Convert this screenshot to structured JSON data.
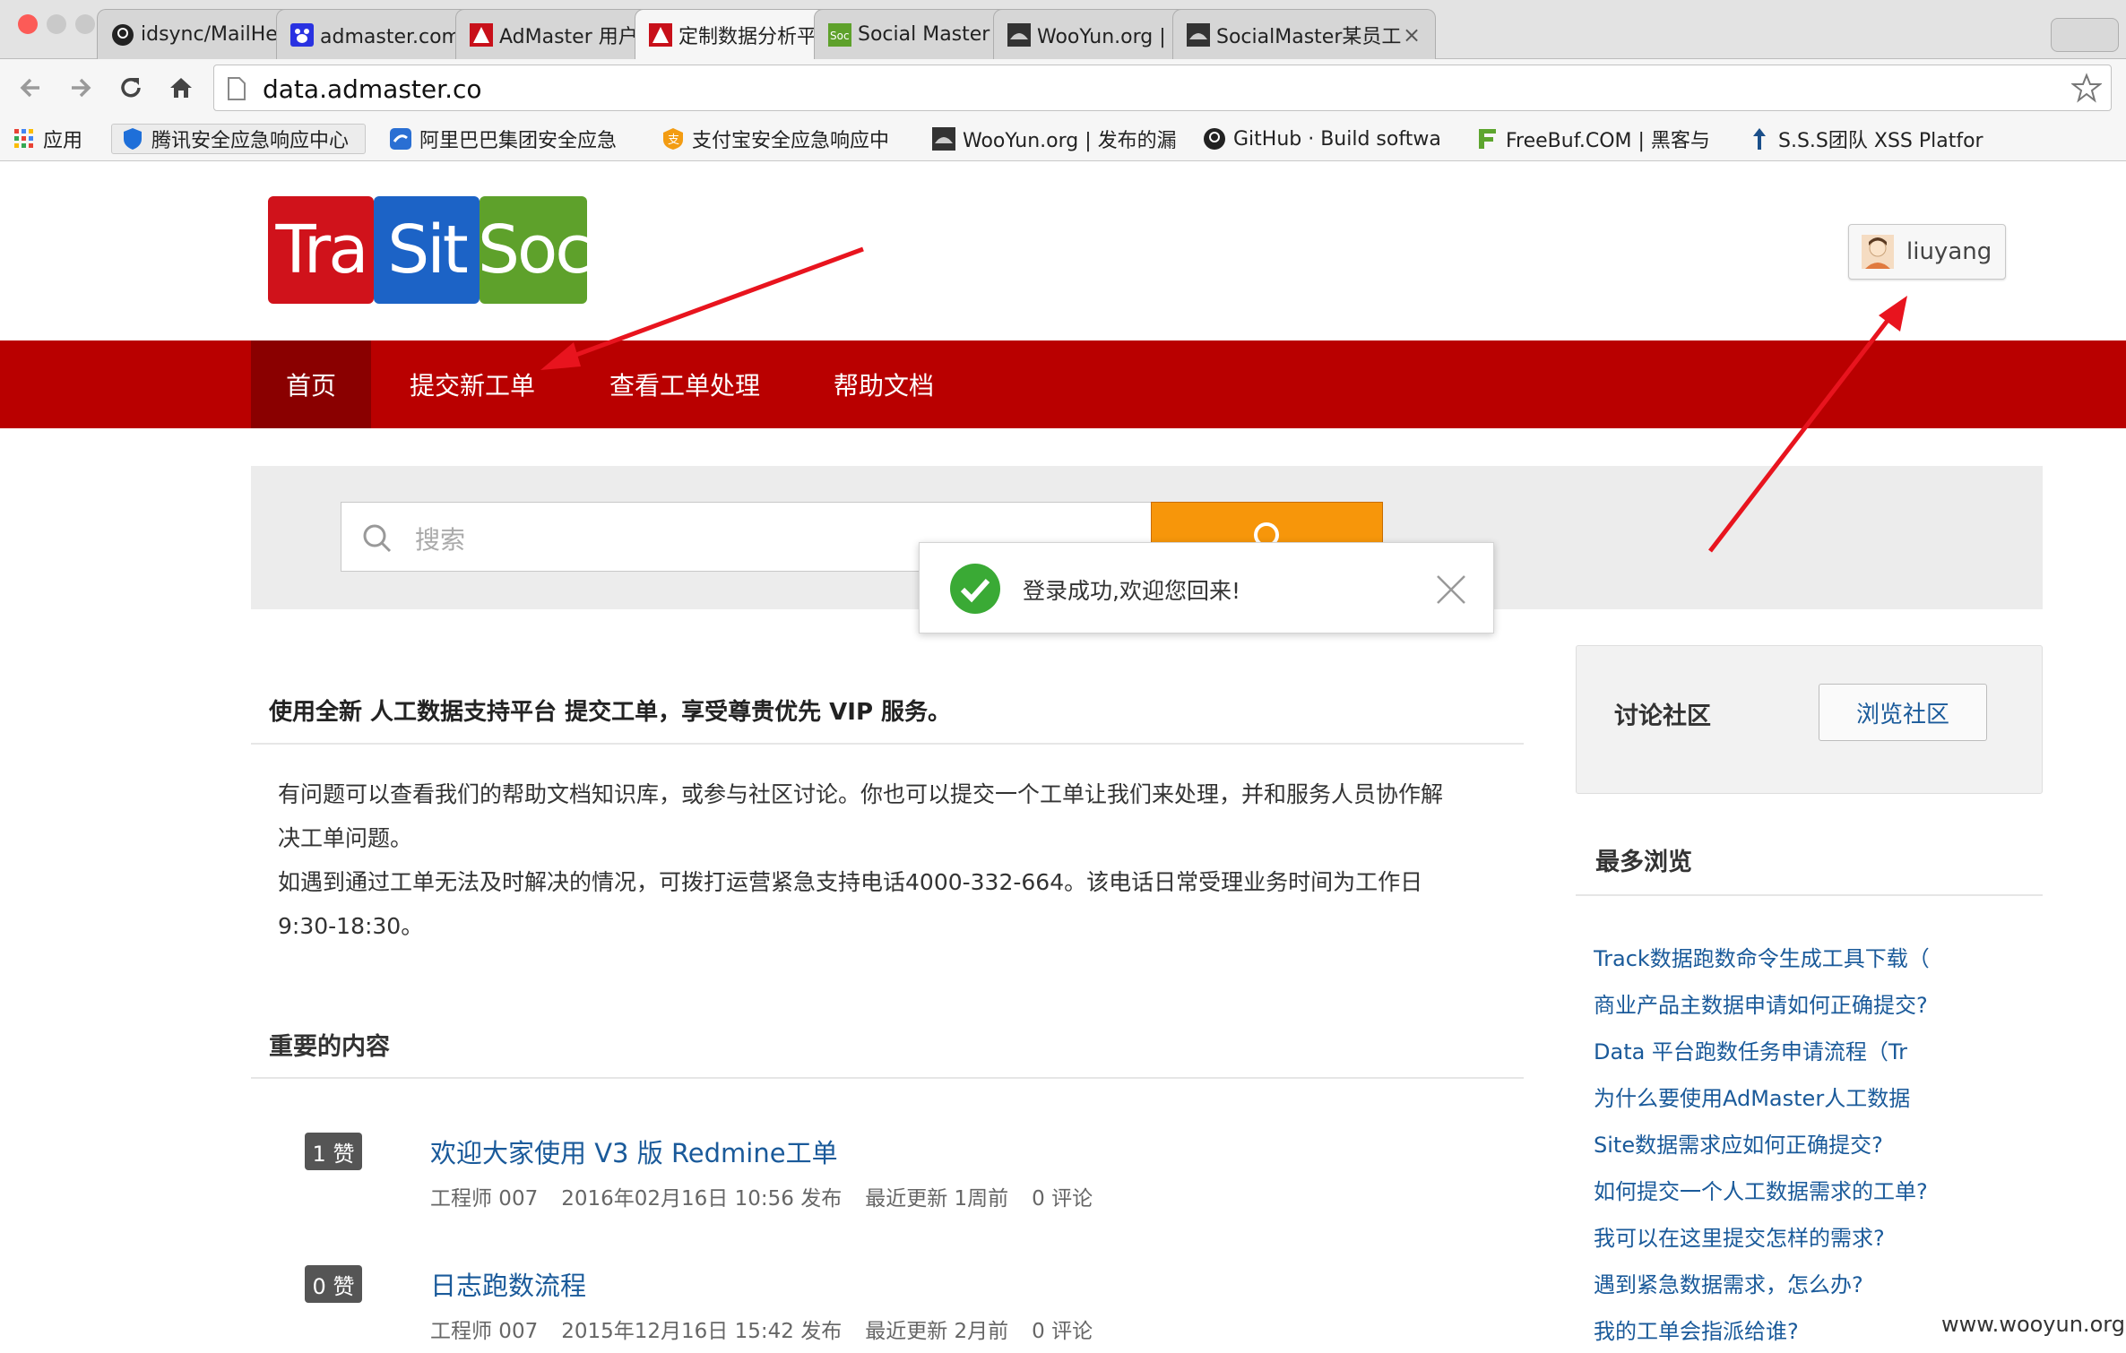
{
  "browser": {
    "tabs": [
      {
        "title": "idsync/MailHelper",
        "icon": "github-icon"
      },
      {
        "title": "admaster.com.cn_百",
        "icon": "baidu-paw-icon"
      },
      {
        "title": "AdMaster 用户中心",
        "icon": "admaster-icon"
      },
      {
        "title": "定制数据分析平台 -",
        "icon": "admaster-icon",
        "active": true
      },
      {
        "title": "Social Master - Adm",
        "icon": "soc-icon"
      },
      {
        "title": "WooYun.org | 提交漏",
        "icon": "wooyun-icon"
      },
      {
        "title": "SocialMaster某员工",
        "icon": "wooyun-icon"
      }
    ],
    "url": "data.admaster.co",
    "bookmarks": [
      {
        "label": "应用",
        "icon": "apps-grid-icon"
      },
      {
        "label": "腾讯安全应急响应中心",
        "icon": "tencent-shield-icon"
      },
      {
        "label": "阿里巴巴集团安全应急",
        "icon": "alibaba-icon"
      },
      {
        "label": "支付宝安全应急响应中",
        "icon": "alipay-icon"
      },
      {
        "label": "WooYun.org | 发布的漏",
        "icon": "wooyun-icon"
      },
      {
        "label": "GitHub · Build softwa",
        "icon": "github-icon"
      },
      {
        "label": "FreeBuf.COM | 黑客与",
        "icon": "freebuf-icon"
      },
      {
        "label": "S.S.S团队 XSS Platfor",
        "icon": "pin-icon"
      }
    ]
  },
  "logo": {
    "parts": [
      "Tra",
      "Sit",
      "Soc"
    ],
    "colors": [
      "#d0121b",
      "#1c63c6",
      "#5ea12b"
    ]
  },
  "user": {
    "name": "liuyang"
  },
  "nav": {
    "items": [
      "首页",
      "提交新工单",
      "查看工单处理",
      "帮助文档"
    ]
  },
  "search": {
    "placeholder": "搜索"
  },
  "toast": {
    "message": "登录成功,欢迎您回来!"
  },
  "intro": {
    "title": "使用全新 人工数据支持平台 提交工单，享受尊贵优先 VIP 服务。",
    "lines": [
      "有问题可以查看我们的帮助文档知识库，或参与社区讨论。你也可以提交一个工单让我们来处理，并和服务人员协作解",
      "决工单问题。",
      "如遇到通过工单无法及时解决的情况，可拨打运营紧急支持电话4000-332-664。该电话日常受理业务时间为工作日",
      "9:30-18:30。"
    ]
  },
  "important": {
    "title": "重要的内容",
    "articles": [
      {
        "votes": "1 赞",
        "title": "欢迎大家使用 V3 版 Redmine工单",
        "author": "工程师 007",
        "published": "2016年02月16日 10:56 发布",
        "updated": "最近更新 1周前",
        "comments": "0 评论"
      },
      {
        "votes": "0 赞",
        "title": "日志跑数流程",
        "author": "工程师 007",
        "published": "2015年12月16日 15:42 发布",
        "updated": "最近更新 2月前",
        "comments": "0 评论"
      }
    ]
  },
  "community": {
    "label": "讨论社区",
    "button": "浏览社区"
  },
  "most_viewed": {
    "title": "最多浏览",
    "items": [
      "Track数据跑数命令生成工具下载（",
      "商业产品主数据申请如何正确提交?",
      "Data 平台跑数任务申请流程（Tr",
      "为什么要使用AdMaster人工数据",
      "Site数据需求应如何正确提交?",
      "如何提交一个人工数据需求的工单?",
      "我可以在这里提交怎样的需求?",
      "遇到紧急数据需求，怎么办?",
      "我的工单会指派给谁?"
    ]
  },
  "watermark": "www.wooyun.org",
  "colors": {
    "nav_red": "#b90000",
    "nav_active": "#8a0000",
    "search_orange": "#f7960a",
    "link_blue": "#1a5a9a",
    "toast_green": "#3aaa35",
    "arrow_red": "#e8141e"
  }
}
